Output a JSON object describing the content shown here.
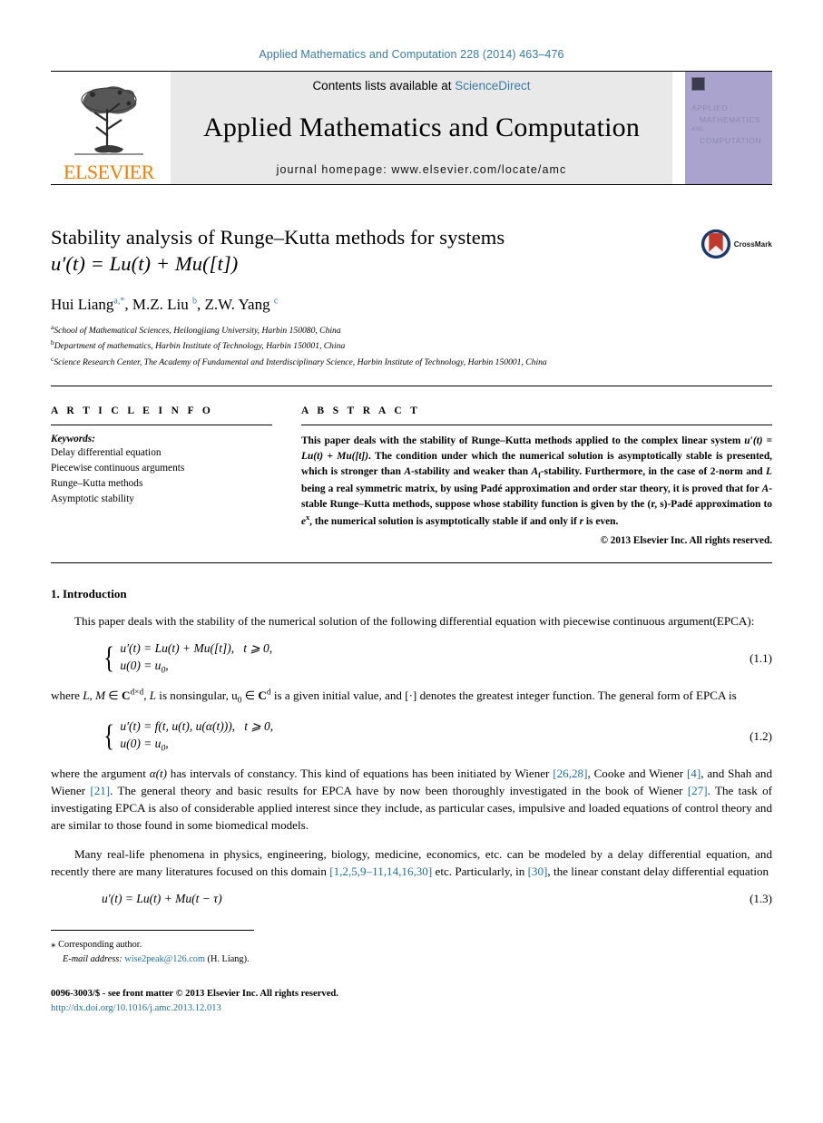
{
  "running_head": "Applied Mathematics and Computation 228 (2014) 463–476",
  "masthead": {
    "publisher": "ELSEVIER",
    "contents_prefix": "Contents lists available at ",
    "contents_link": "ScienceDirect",
    "journal_title": "Applied Mathematics and Computation",
    "homepage": "journal homepage: www.elsevier.com/locate/amc",
    "cover": {
      "line1": "APPLIED",
      "line2": "MATHEMATICS",
      "line3": "AND",
      "line4": "COMPUTATION"
    }
  },
  "article": {
    "title_line1": "Stability analysis of Runge–Kutta methods for systems",
    "title_line2": "u′(t) = Lu(t) + Mu([t])",
    "crossmark_label": "CrossMark",
    "authors": "Hui Liang",
    "author_sup_a": "a,*",
    "author2": ", M.Z. Liu ",
    "author_sup_b": "b",
    "author3": ", Z.W. Yang ",
    "author_sup_c": "c",
    "affiliations": [
      {
        "sup": "a",
        "text": "School of Mathematical Sciences, Heilongjiang University, Harbin 150080, China"
      },
      {
        "sup": "b",
        "text": "Department of mathematics, Harbin Institute of Technology, Harbin 150001, China"
      },
      {
        "sup": "c",
        "text": "Science Research Center, The Academy of Fundamental and Interdisciplinary Science, Harbin Institute of Technology, Harbin 150001, China"
      }
    ]
  },
  "article_info": {
    "heading": "A R T I C L E    I N F O",
    "keywords_label": "Keywords:",
    "keywords": [
      "Delay differential equation",
      "Piecewise continuous arguments",
      "Runge–Kutta methods",
      "Asymptotic stability"
    ]
  },
  "abstract": {
    "heading": "A B S T R A C T",
    "text_part1": "This paper deals with the stability of Runge–Kutta methods applied to the complex linear system ",
    "eq_inline": "u′(t) = Lu(t) + Mu([t])",
    "text_part2": ". The condition under which the numerical solution is asymptotically stable is presented, which is stronger than ",
    "a_stability": "A",
    "text_part3": "-stability and weaker than ",
    "af_stability": "A",
    "af_sub": "f",
    "text_part4": "-stability. Furthermore, in the case of 2-norm and ",
    "L_sym": "L",
    "text_part5": " being a real symmetric matrix, by using Padé approximation and order star theory, it is proved that for ",
    "a2": "A",
    "text_part6": "-stable Runge–Kutta methods, suppose whose stability function is given by the (r, s)-Padé approximation to ",
    "e_x": "e",
    "e_sup": "x",
    "text_part7": ", the numerical solution is asymptotically stable if and only if ",
    "r_italic": "r",
    "text_part8": " is even.",
    "copyright": "© 2013 Elsevier Inc. All rights reserved."
  },
  "body": {
    "section_heading": "1. Introduction",
    "par1": "This paper deals with the stability of the numerical solution of the following differential equation with piecewise continuous argument(EPCA):",
    "eq11": {
      "line1": "u′(t) = Lu(t) + Mu([t]),",
      "line1b": "t ⩾ 0,",
      "line2": "u(0) = u",
      "line2sub": "0",
      "line2b": ",",
      "number": "(1.1)"
    },
    "par2_a": "where ",
    "par2_L": "L, M",
    "par2_b": " ∈ ",
    "par2_C": "C",
    "par2_Csup": "d×d",
    "par2_c": ", ",
    "par2_L2": "L",
    "par2_d": " is nonsingular, u",
    "par2_sub0": "0",
    "par2_e": " ∈ ",
    "par2_C2": "C",
    "par2_C2sup": "d",
    "par2_f": " is a given initial value, and [·] denotes the greatest integer function. The general form of EPCA is",
    "eq12": {
      "line1": "u′(t) = f(t, u(t), u(α(t))),",
      "line1b": "t ⩾ 0,",
      "line2": "u(0) = u",
      "line2sub": "0",
      "line2b": ",",
      "number": "(1.2)"
    },
    "par3_a": "where the argument ",
    "par3_alpha": "α(t)",
    "par3_b": " has intervals of constancy. This kind of equations has been initiated by Wiener ",
    "cite1": "[26,28]",
    "par3_c": ", Cooke and Wiener ",
    "cite2": "[4]",
    "par3_d": ", and Shah and Wiener ",
    "cite3": "[21]",
    "par3_e": ". The general theory and basic results for EPCA have by now been thoroughly investigated in the book of Wiener ",
    "cite4": "[27]",
    "par3_f": ". The task of investigating EPCA is also of considerable applied interest since they include, as particular cases, impulsive and loaded equations of control theory and are similar to those found in some biomedical models.",
    "par4_a": "Many real-life phenomena in physics, engineering, biology, medicine, economics, etc. can be modeled by a delay differential equation, and recently there are many literatures focused on this domain ",
    "cite5": "[1,2,5,9–11,14,16,30]",
    "par4_b": " etc. Particularly, in ",
    "cite6": "[30]",
    "par4_c": ", the linear constant delay differential equation",
    "eq13": {
      "text": "u′(t) = Lu(t) + Mu(t − τ)",
      "number": "(1.3)"
    }
  },
  "footnote": {
    "star": "⁎",
    "corresponding": "Corresponding author.",
    "email_label": "E-mail address:",
    "email": "wise2peak@126.com",
    "email_owner": "(H. Liang)."
  },
  "footer": {
    "issn": "0096-3003/$ - see front matter © 2013 Elsevier Inc. All rights reserved.",
    "doi": "http://dx.doi.org/10.1016/j.amc.2013.12.013"
  }
}
